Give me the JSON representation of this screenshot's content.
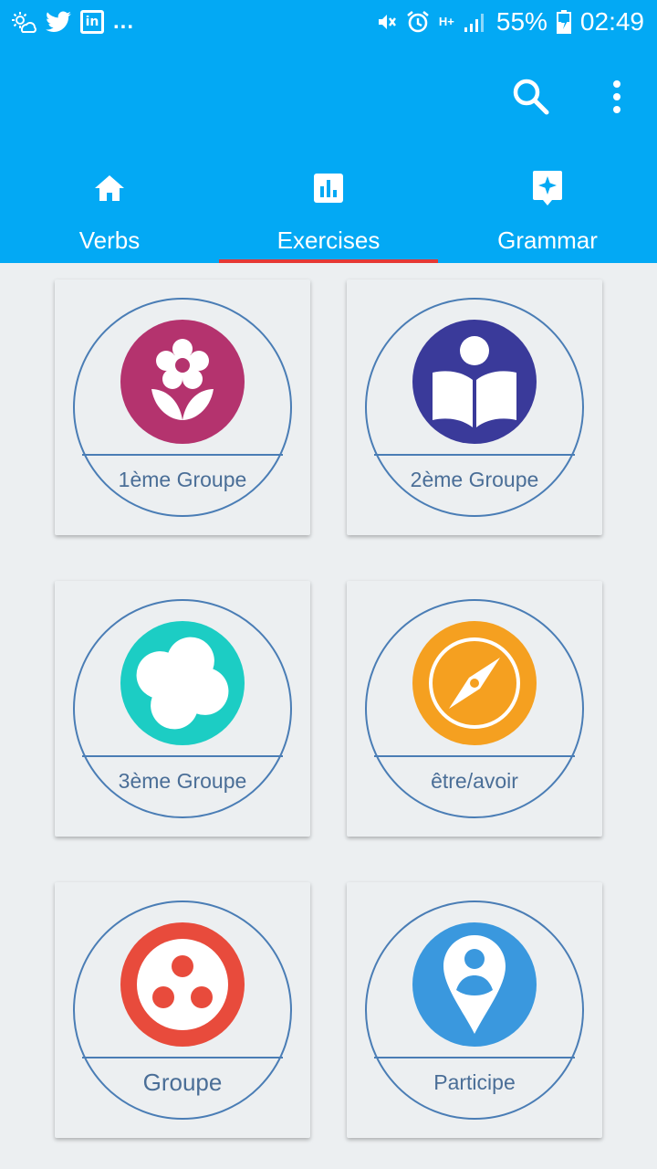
{
  "status_bar": {
    "ellipsis": "...",
    "battery_percent": "55%",
    "time": "02:49",
    "network_label": "H+"
  },
  "app_bar": {
    "background": "#03a9f4",
    "actions": [
      "search-icon",
      "more-vert-icon"
    ]
  },
  "tabs": [
    {
      "label": "Verbs",
      "icon": "home-icon",
      "active": false
    },
    {
      "label": "Exercises",
      "icon": "bar-chart-icon",
      "active": true
    },
    {
      "label": "Grammar",
      "icon": "sparkle-badge-icon",
      "active": false
    }
  ],
  "cards": [
    {
      "label": "1ème Groupe",
      "icon": "flower-icon",
      "color": "#b4336e"
    },
    {
      "label": "2ème Groupe",
      "icon": "reader-book-icon",
      "color": "#3a3a9a"
    },
    {
      "label": "3ème Groupe",
      "icon": "pinwheel-icon",
      "color": "#1ccdc4"
    },
    {
      "label": "être/avoir",
      "icon": "compass-icon",
      "color": "#f5a020"
    },
    {
      "label": "Groupe",
      "icon": "three-dots-icon",
      "color": "#e84b3c"
    },
    {
      "label": "Participe",
      "icon": "location-person-icon",
      "color": "#3a98de"
    }
  ],
  "colors": {
    "accent": "#03a9f4",
    "tab_indicator": "#e53935",
    "card_outline": "#4a7db5",
    "card_text": "#4a6e97"
  }
}
